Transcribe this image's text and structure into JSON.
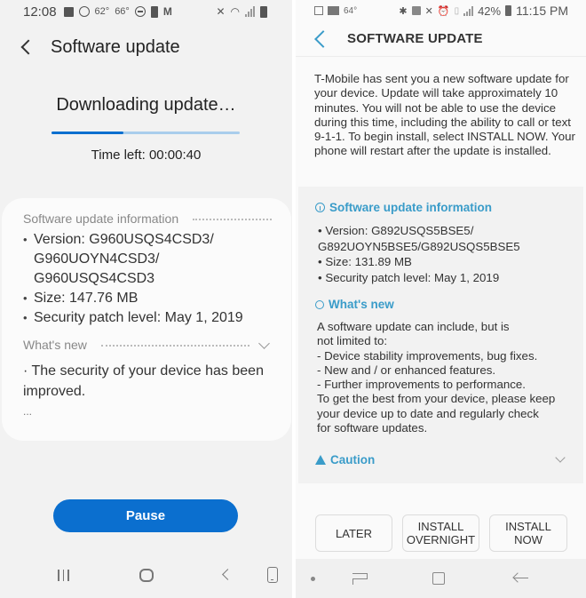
{
  "left_phone": {
    "status_bar": {
      "time": "12:08",
      "temp1": "62°",
      "temp2": "66°",
      "icons_left": [
        "notification-app-icon",
        "camera-ring-icon",
        "do-not-disturb-icon",
        "battery-saver-icon",
        "malwarebytes-icon"
      ],
      "icons_right": [
        "vibrate-mute-icon",
        "wifi-icon",
        "cell-signal-icon",
        "battery-icon"
      ]
    },
    "header": {
      "title": "Software update",
      "back_icon": "chevron-left-icon"
    },
    "download": {
      "status": "Downloading update…",
      "progress_percent": 38,
      "time_left": "Time left: 00:00:40"
    },
    "info_card": {
      "heading": "Software update information",
      "items": [
        "Version: G960USQS4CSD3/ G960UOYN4CSD3/ G960USQS4CSD3",
        "Size: 147.76 MB",
        "Security patch level: May 1, 2019"
      ],
      "whats_new_heading": "What's new",
      "whats_new_text": "· The security of your device has been improved.",
      "more": "..."
    },
    "pause_button": "Pause",
    "nav_bar": [
      "recents-icon",
      "home-icon",
      "back-icon",
      "keyboard-toggle-icon"
    ],
    "colors": {
      "accent": "#0b6fcf",
      "progress_track": "#a9cdec",
      "background": "#f2f2f2"
    }
  },
  "right_phone": {
    "status_bar": {
      "temp": "64°",
      "battery": "42%",
      "time": "11:15 PM",
      "icons_left": [
        "checkbox-icon",
        "gallery-icon"
      ],
      "icons_right": [
        "bluetooth-icon",
        "nfc-icon",
        "mute-icon",
        "alarm-icon",
        "sim-icon",
        "cell-signal-icon",
        "battery-icon"
      ]
    },
    "header": {
      "title": "SOFTWARE UPDATE",
      "back_icon": "chevron-left-icon"
    },
    "intro": "T-Mobile has sent you a new software update for your device. Update will take approximately 10 minutes. You will not be able to use the device during this time, including the ability to call or text 9-1-1. To begin install, select INSTALL NOW. Your phone will restart after the update is installed.",
    "info_section": {
      "heading": "Software update information",
      "items": [
        "• Version: G892USQS5BSE5/",
        "G892UOYN5BSE5/G892USQS5BSE5",
        "• Size: 131.89 MB",
        "• Security patch level: May 1, 2019"
      ]
    },
    "whats_new": {
      "heading": "What's new",
      "text": "A software update can include, but is\nnot limited to:\n - Device stability improvements, bug fixes.\n - New and / or enhanced features.\n - Further improvements to performance.\nTo get the best from your device, please keep\nyour device up to date and regularly check\nfor software updates."
    },
    "caution": {
      "heading": "Caution"
    },
    "buttons": {
      "later": "LATER",
      "overnight": "INSTALL OVERNIGHT",
      "now": "INSTALL NOW"
    },
    "nav_bar": [
      "dot-indicator",
      "recents-icon",
      "home-icon",
      "back-icon"
    ],
    "colors": {
      "accent": "#3a9cc9",
      "panel": "#f2f2f2",
      "background": "#fafafa"
    }
  }
}
